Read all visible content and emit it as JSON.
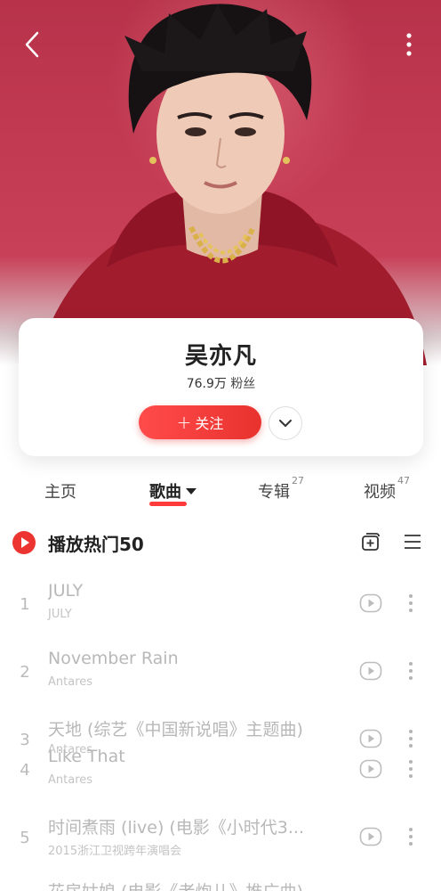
{
  "artist": {
    "name": "吴亦凡",
    "fans_count": "76.9万",
    "fans_label": "粉丝",
    "follow_label": "关注"
  },
  "tabs": [
    {
      "label": "主页",
      "count": ""
    },
    {
      "label": "歌曲",
      "count": ""
    },
    {
      "label": "专辑",
      "count": "27"
    },
    {
      "label": "视频",
      "count": "47"
    }
  ],
  "playall": {
    "label": "播放热门50"
  },
  "songs": [
    {
      "index": "1",
      "title": "JULY",
      "subtitle": "JULY"
    },
    {
      "index": "2",
      "title": "November Rain",
      "subtitle": "Antares"
    },
    {
      "index": "3",
      "title": "天地 (综艺《中国新说唱》主题曲)",
      "subtitle": "Antares"
    },
    {
      "index": "4",
      "title": "Like That",
      "subtitle": "Antares"
    },
    {
      "index": "5",
      "title": "时间煮雨 (live) (电影《小时代3...",
      "subtitle": "2015浙江卫视跨年演唱会"
    },
    {
      "index": "",
      "title": "花房姑娘 (电影《老炮儿》推广曲)",
      "subtitle": ""
    }
  ],
  "colors": {
    "accent": "#ec3530",
    "hero": "#c23a52"
  },
  "icons": {
    "back": "chevron-left-icon",
    "more": "more-vertical-icon",
    "expand": "chevron-down-icon",
    "play": "play-circle-icon",
    "add": "add-to-collection-icon",
    "list": "list-select-icon",
    "mv": "mv-play-icon"
  }
}
